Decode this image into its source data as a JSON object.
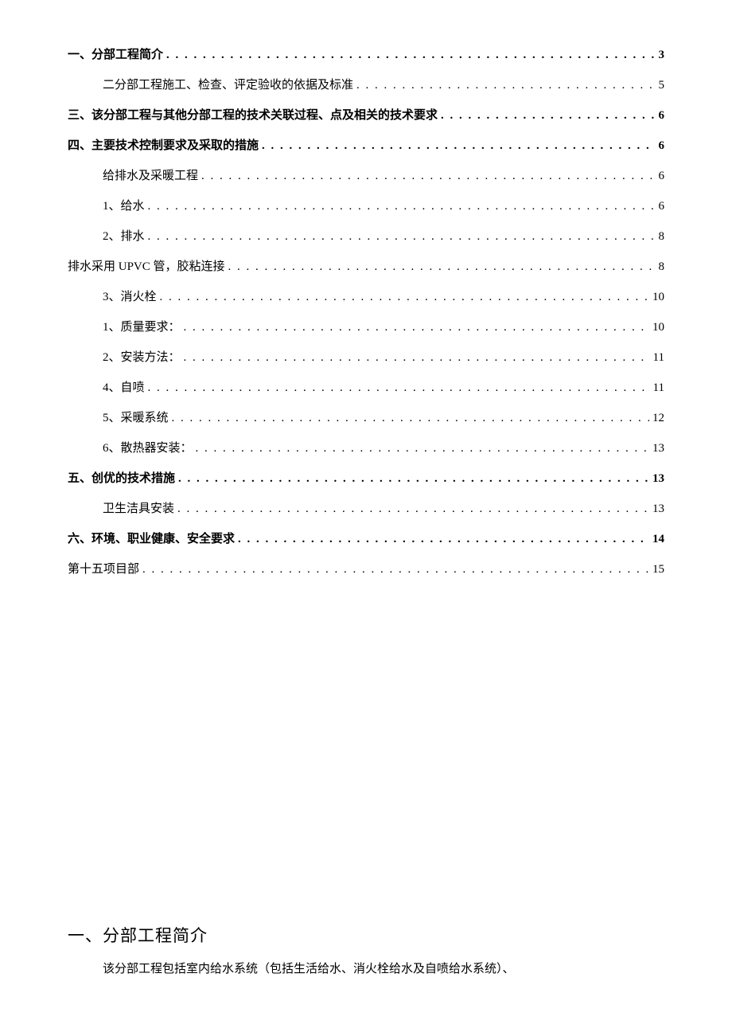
{
  "toc": [
    {
      "label": "一、分部工程简介",
      "page": "3",
      "indent": 1,
      "bold": true
    },
    {
      "label": "二分部工程施工、检查、评定验收的依据及标准",
      "page": "5",
      "indent": 2,
      "bold": false
    },
    {
      "label": "三、该分部工程与其他分部工程的技术关联过程、点及相关的技术要求",
      "page": "6",
      "indent": 1,
      "bold": true
    },
    {
      "label": "四、主要技术控制要求及采取的措施",
      "page": "6",
      "indent": 1,
      "bold": true
    },
    {
      "label": "给排水及采暖工程",
      "page": "6",
      "indent": 2,
      "bold": false
    },
    {
      "label": "1、给水",
      "page": "6",
      "indent": 2,
      "bold": false
    },
    {
      "label": "2、排水",
      "page": "8",
      "indent": 2,
      "bold": false
    },
    {
      "label": "排水采用 UPVC 管，胶粘连接",
      "page": "8",
      "indent": 1,
      "bold": false
    },
    {
      "label": "3、消火栓",
      "page": "10",
      "indent": 2,
      "bold": false
    },
    {
      "label": "1、质量要求：",
      "page": "10",
      "indent": 2,
      "bold": false
    },
    {
      "label": "2、安装方法：",
      "page": "11",
      "indent": 2,
      "bold": false
    },
    {
      "label": "4、自喷",
      "page": "11",
      "indent": 2,
      "bold": false
    },
    {
      "label": "5、采暖系统",
      "page": "12",
      "indent": 2,
      "bold": false
    },
    {
      "label": "6、散热器安装：",
      "page": "13",
      "indent": 2,
      "bold": false
    },
    {
      "label": "五、创优的技术措施",
      "page": "13",
      "indent": 1,
      "bold": true
    },
    {
      "label": "卫生洁具安装",
      "page": "13",
      "indent": 2,
      "bold": false
    },
    {
      "label": "六、环境、职业健康、安全要求",
      "page": "14",
      "indent": 1,
      "bold": true
    },
    {
      "label": "第十五项目部",
      "page": "15",
      "indent": 1,
      "bold": false
    }
  ],
  "section": {
    "heading": "一、分部工程简介",
    "body": "该分部工程包括室内给水系统（包括生活给水、消火栓给水及自喷给水系统）、"
  }
}
